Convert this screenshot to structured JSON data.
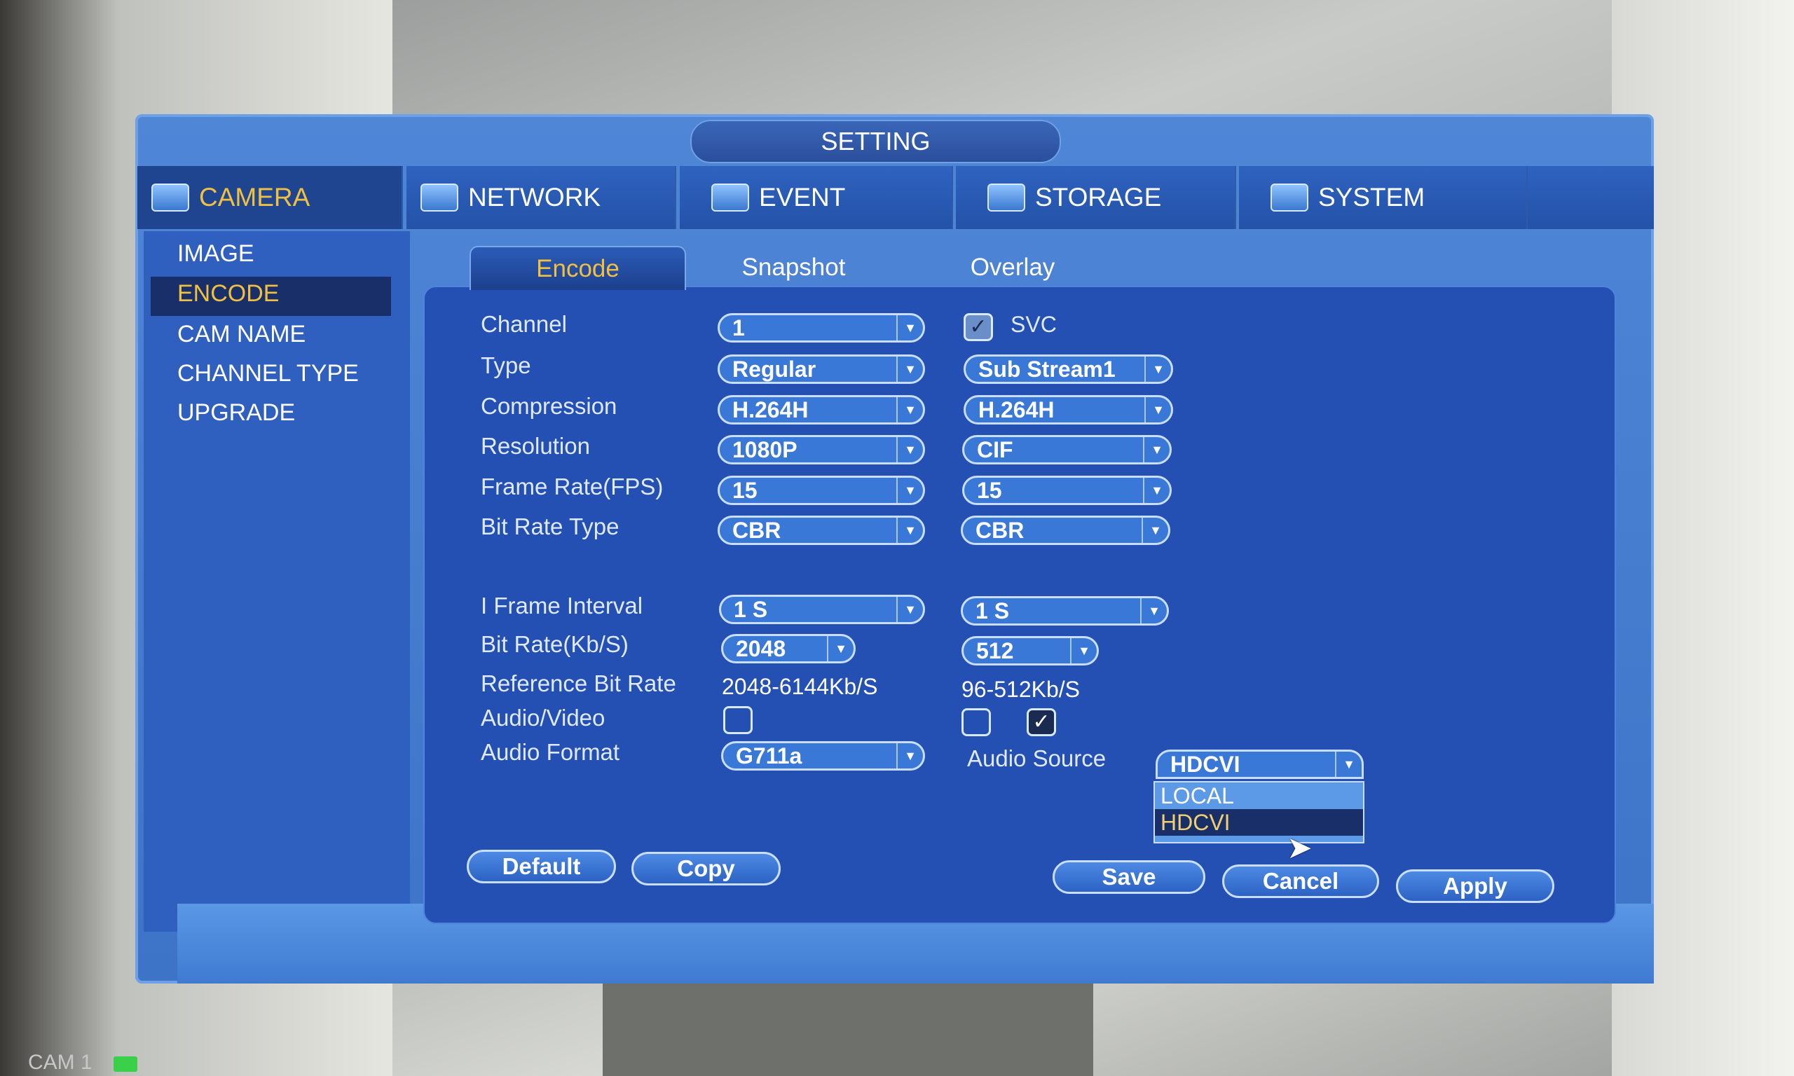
{
  "window": {
    "title": "SETTING"
  },
  "top_tabs": [
    {
      "label": "CAMERA",
      "icon": "camera-icon",
      "active": true
    },
    {
      "label": "NETWORK",
      "icon": "network-icon"
    },
    {
      "label": "EVENT",
      "icon": "event-icon"
    },
    {
      "label": "STORAGE",
      "icon": "storage-icon"
    },
    {
      "label": "SYSTEM",
      "icon": "system-icon"
    }
  ],
  "sidebar": {
    "items": [
      {
        "label": "IMAGE"
      },
      {
        "label": "ENCODE",
        "selected": true
      },
      {
        "label": "CAM NAME"
      },
      {
        "label": "CHANNEL TYPE"
      },
      {
        "label": "UPGRADE"
      }
    ]
  },
  "sub_tabs": [
    {
      "label": "Encode",
      "active": true
    },
    {
      "label": "Snapshot"
    },
    {
      "label": "Overlay"
    }
  ],
  "form": {
    "channel": {
      "label": "Channel",
      "value": "1"
    },
    "svc": {
      "label": "SVC",
      "checked": true
    },
    "type": {
      "label": "Type",
      "main": "Regular",
      "sub": "Sub Stream1"
    },
    "compression": {
      "label": "Compression",
      "main": "H.264H",
      "sub": "H.264H"
    },
    "resolution": {
      "label": "Resolution",
      "main": "1080P",
      "sub": "CIF"
    },
    "frame_rate": {
      "label": "Frame Rate(FPS)",
      "main": "15",
      "sub": "15"
    },
    "bit_rate_type": {
      "label": "Bit Rate Type",
      "main": "CBR",
      "sub": "CBR"
    },
    "iframe": {
      "label": "I Frame Interval",
      "main": "1 S",
      "sub": "1 S"
    },
    "bit_rate": {
      "label": "Bit Rate(Kb/S)",
      "main": "2048",
      "sub": "512"
    },
    "ref_bit_rate": {
      "label": "Reference Bit Rate",
      "main": "2048-6144Kb/S",
      "sub": "96-512Kb/S"
    },
    "audio_video": {
      "label": "Audio/Video",
      "main_checked": false,
      "sub_checked": false,
      "sub_extra_checked": true
    },
    "audio_format": {
      "label": "Audio Format",
      "value": "G711a"
    },
    "audio_source": {
      "label": "Audio Source",
      "value": "HDCVI",
      "options": [
        "LOCAL",
        "HDCVI"
      ],
      "highlighted": "HDCVI"
    }
  },
  "buttons": {
    "default": "Default",
    "copy": "Copy",
    "save": "Save",
    "cancel": "Cancel",
    "apply": "Apply"
  },
  "overlay": {
    "camera_label": "CAM 1"
  }
}
